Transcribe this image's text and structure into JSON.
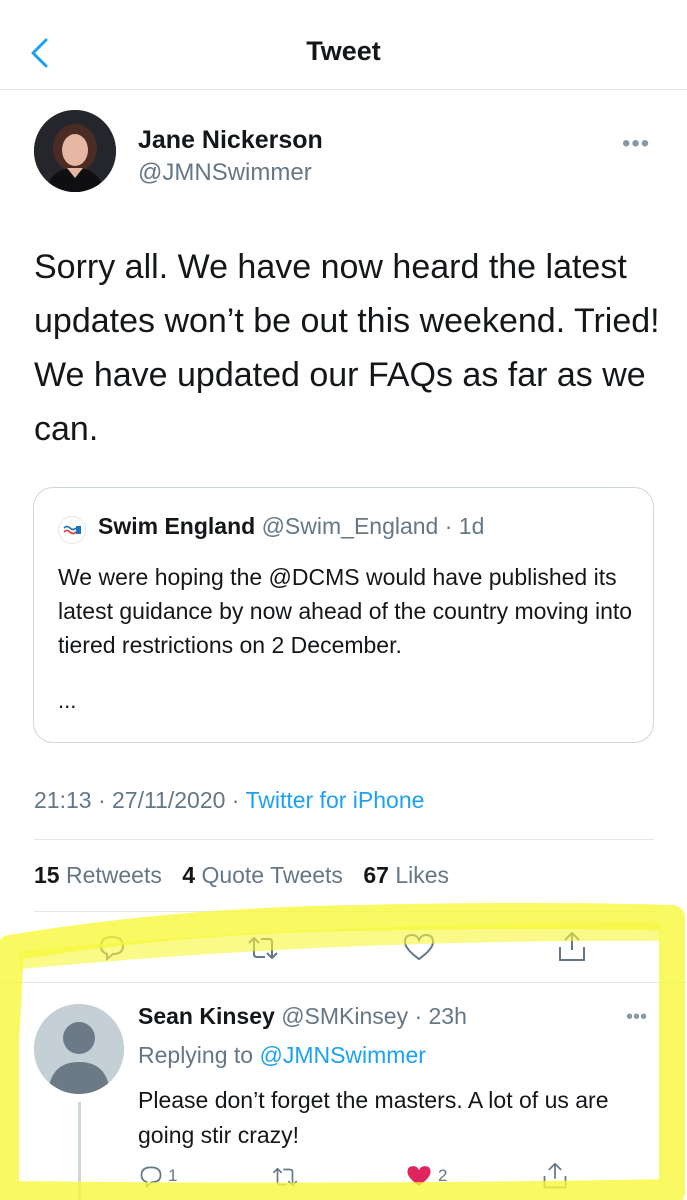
{
  "header": {
    "title": "Tweet"
  },
  "tweet": {
    "author_name": "Jane Nickerson",
    "author_handle": "@JMNSwimmer",
    "more": "•••",
    "text": "Sorry all. We have now heard the latest updates won’t be out this weekend. Tried!  We have updated our FAQs as far as we can.",
    "quote": {
      "name": "Swim England",
      "handle": "@Swim_England · 1d",
      "text": "We were hoping the @DCMS would have published its latest guidance by now ahead of the country moving into tiered restrictions on 2 December.",
      "ellipsis": "..."
    },
    "time": "21:13 · 27/11/2020 · ",
    "source": "Twitter for iPhone",
    "stats": {
      "retweets_count": "15",
      "retweets_label": "Retweets",
      "quotes_count": "4",
      "quotes_label": "Quote Tweets",
      "likes_count": "67",
      "likes_label": "Likes"
    }
  },
  "reply": {
    "name": "Sean Kinsey",
    "handle": "@SMKinsey · 23h",
    "more": "•••",
    "replying_prefix": "Replying to ",
    "replying_to": "@JMNSwimmer",
    "text": "Please don’t forget the masters. A lot of us are going stir crazy!",
    "reply_count": "1",
    "like_count": "2"
  },
  "colors": {
    "accent": "#1da1f2",
    "secondary_text": "#657786",
    "highlight": "#f7f73a",
    "like_heart": "#e0245e"
  }
}
